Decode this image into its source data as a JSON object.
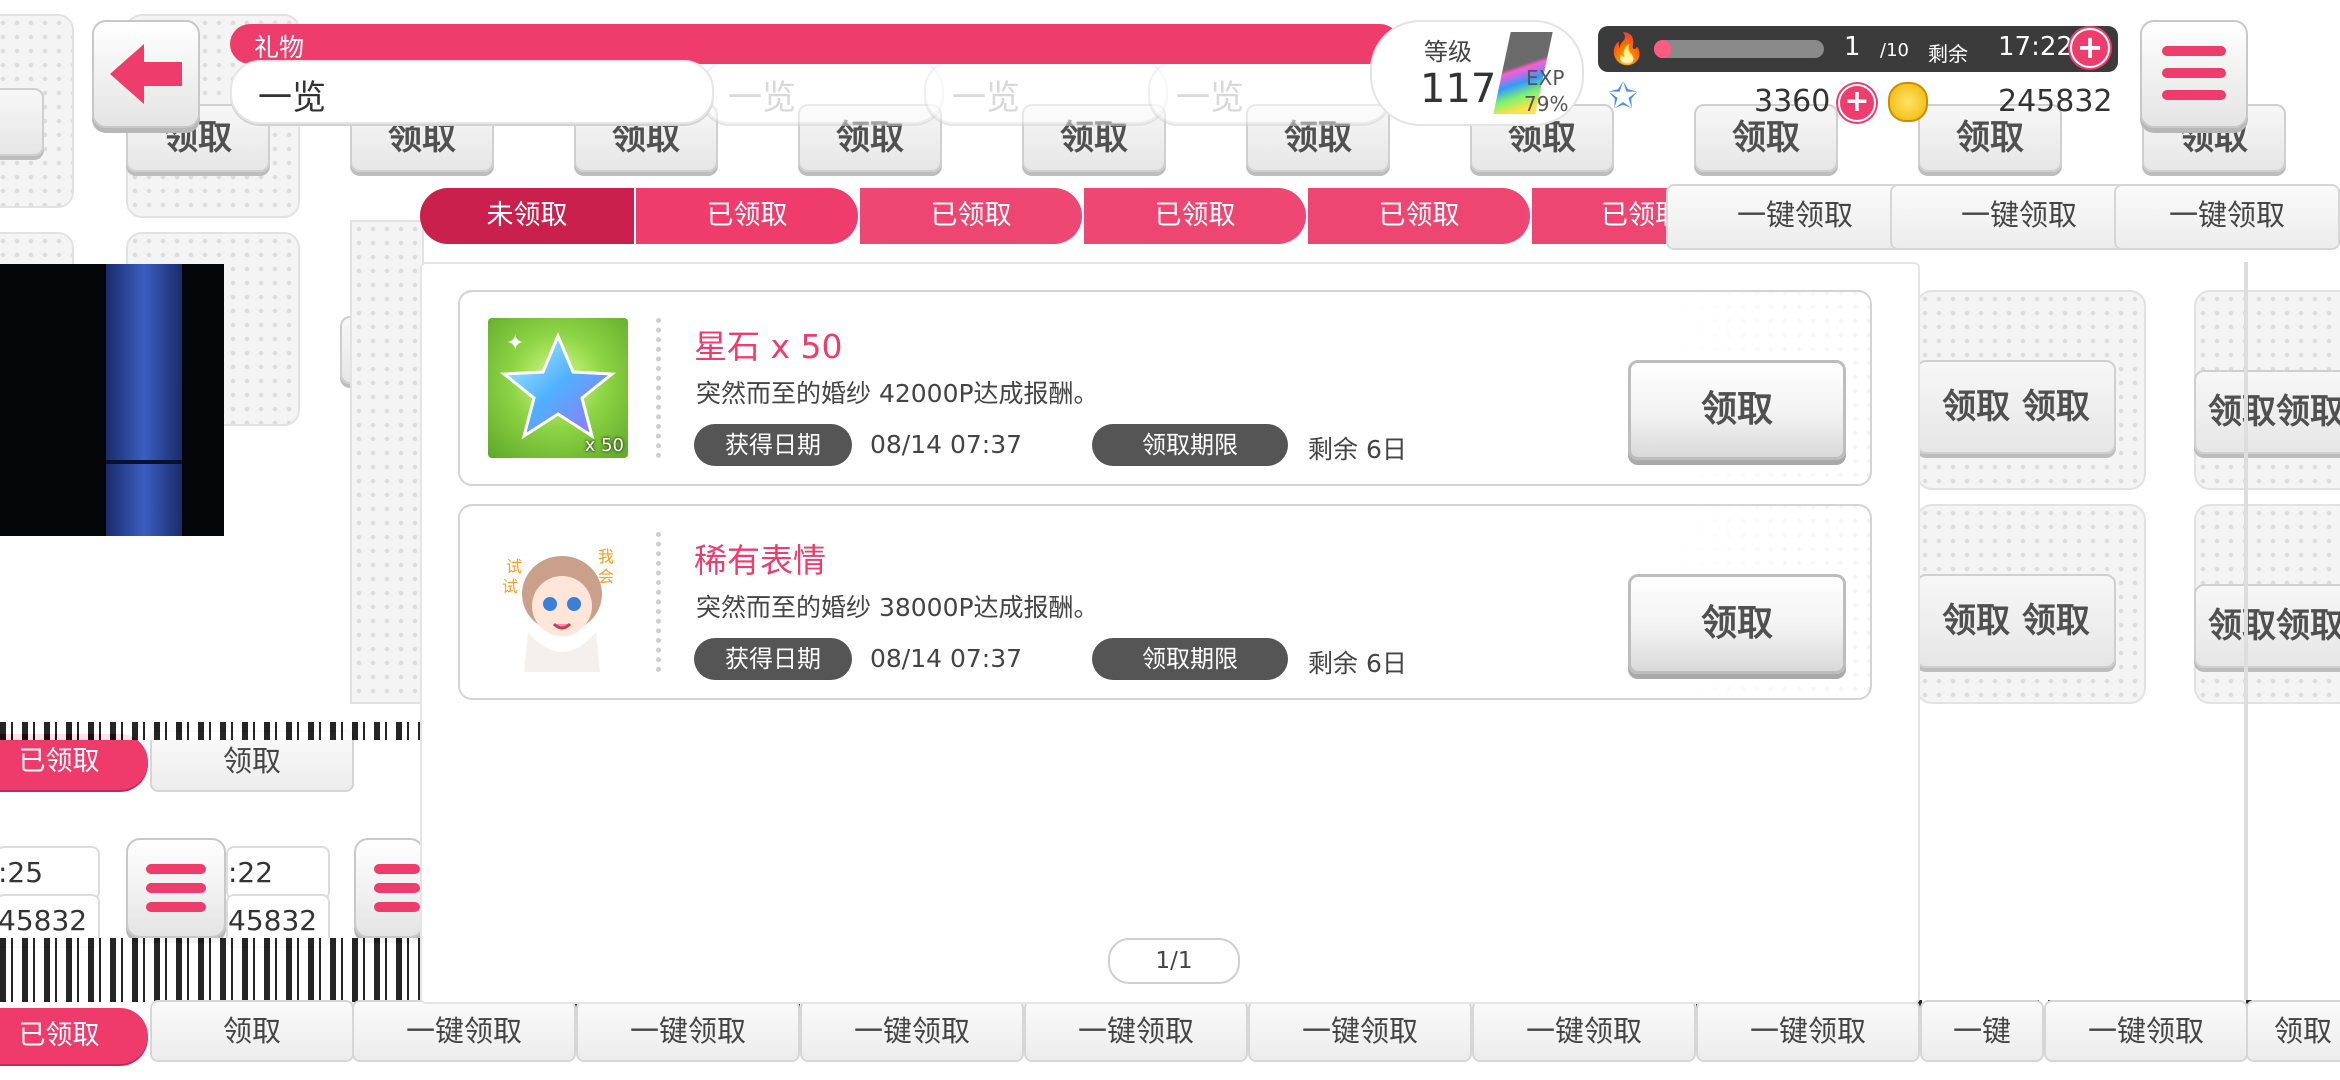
{
  "header": {
    "title": "礼物",
    "subtitle": "一览",
    "level_label": "等级",
    "level": "117",
    "exp_label": "EXP",
    "exp_percent": "79%",
    "stamina_current": "1",
    "stamina_max": "/10",
    "remaining_label": "剩余",
    "time": "17:22",
    "star_stones": "3360",
    "coins": "245832",
    "stamina_fraction": 0.1
  },
  "tabs": [
    {
      "label": "未领取"
    },
    {
      "label": "已领取"
    }
  ],
  "claim_all_label": "一键领取",
  "items": [
    {
      "name": "星石 x 50",
      "qty_badge": "x 50",
      "description": "突然而至的婚纱 42000P达成报酬。",
      "obtained_label": "获得日期",
      "obtained_date": "08/14 07:37",
      "deadline_label": "领取期限",
      "remaining": "剩余 6日",
      "button": "领取"
    },
    {
      "name": "稀有表情",
      "qty_badge": "",
      "description": "突然而至的婚纱 38000P达成报酬。",
      "obtained_label": "获得日期",
      "obtained_date": "08/14 07:37",
      "deadline_label": "领取期限",
      "remaining": "剩余 6日",
      "button": "领取"
    }
  ],
  "pager": "1/1",
  "ghost": {
    "claim": "领取",
    "claimed": "已领取",
    "claim_all": "一键领取",
    "one_key": "一键",
    "subtitle": "一览",
    "time_a": ":25",
    "time_b": ":22",
    "coins_short": "45832",
    "level": "117"
  },
  "colors": {
    "accent": "#ee3d6c",
    "accent_dark": "#c9204e",
    "tag_bg": "#555555"
  },
  "icons": [
    "back-arrow-icon",
    "menu-icon",
    "flame-icon",
    "star-icon",
    "coin-icon",
    "plus-icon",
    "star-stone-icon",
    "sticker-icon"
  ]
}
